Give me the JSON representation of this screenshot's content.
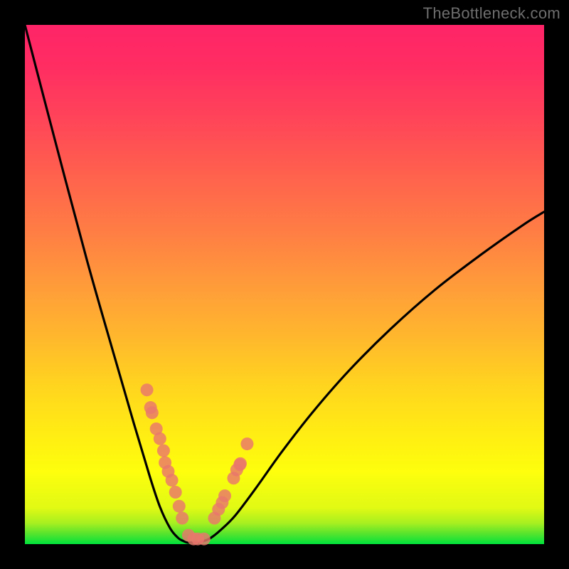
{
  "watermark": "TheBottleneck.com",
  "chart_data": {
    "type": "line",
    "title": "",
    "xlabel": "",
    "ylabel": "",
    "xlim": [
      0,
      100
    ],
    "ylim": [
      0,
      100
    ],
    "grid": false,
    "legend": false,
    "series": [
      {
        "name": "bottleneck-curve",
        "x_norm": [
          0.0,
          0.06,
          0.12,
          0.17,
          0.21,
          0.24,
          0.26,
          0.28,
          0.295,
          0.305,
          0.313,
          0.32,
          0.33,
          0.342,
          0.358,
          0.378,
          0.405,
          0.445,
          0.495,
          0.555,
          0.625,
          0.705,
          0.79,
          0.875,
          0.96,
          1.0
        ],
        "y_norm": [
          1.0,
          0.77,
          0.545,
          0.37,
          0.232,
          0.132,
          0.072,
          0.03,
          0.012,
          0.006,
          0.003,
          0.003,
          0.003,
          0.005,
          0.012,
          0.028,
          0.055,
          0.108,
          0.178,
          0.255,
          0.335,
          0.415,
          0.49,
          0.555,
          0.615,
          0.64
        ]
      }
    ],
    "highlight_points": {
      "name": "marker-cluster",
      "x_norm": [
        0.235,
        0.242,
        0.245,
        0.253,
        0.26,
        0.267,
        0.27,
        0.276,
        0.283,
        0.29,
        0.297,
        0.303,
        0.315,
        0.325,
        0.333,
        0.345,
        0.365,
        0.373,
        0.38,
        0.385,
        0.402,
        0.408,
        0.414,
        0.415,
        0.428
      ],
      "y_norm": [
        0.297,
        0.263,
        0.253,
        0.222,
        0.203,
        0.18,
        0.157,
        0.14,
        0.123,
        0.1,
        0.073,
        0.05,
        0.017,
        0.01,
        0.01,
        0.01,
        0.05,
        0.067,
        0.08,
        0.093,
        0.127,
        0.143,
        0.153,
        0.155,
        0.193
      ]
    },
    "gradient_stops": [
      {
        "pos": 0.0,
        "color": "#00e23b"
      },
      {
        "pos": 0.02,
        "color": "#56e42e"
      },
      {
        "pos": 0.04,
        "color": "#a6ef20"
      },
      {
        "pos": 0.07,
        "color": "#e1fa14"
      },
      {
        "pos": 0.14,
        "color": "#fefe0d"
      },
      {
        "pos": 0.2,
        "color": "#fff012"
      },
      {
        "pos": 0.3,
        "color": "#ffd61e"
      },
      {
        "pos": 0.4,
        "color": "#ffb72d"
      },
      {
        "pos": 0.5,
        "color": "#ff9b3a"
      },
      {
        "pos": 0.6,
        "color": "#ff7e44"
      },
      {
        "pos": 0.72,
        "color": "#ff5f4e"
      },
      {
        "pos": 0.82,
        "color": "#ff4459"
      },
      {
        "pos": 0.92,
        "color": "#ff2d62"
      },
      {
        "pos": 1.0,
        "color": "#ff2468"
      }
    ]
  }
}
